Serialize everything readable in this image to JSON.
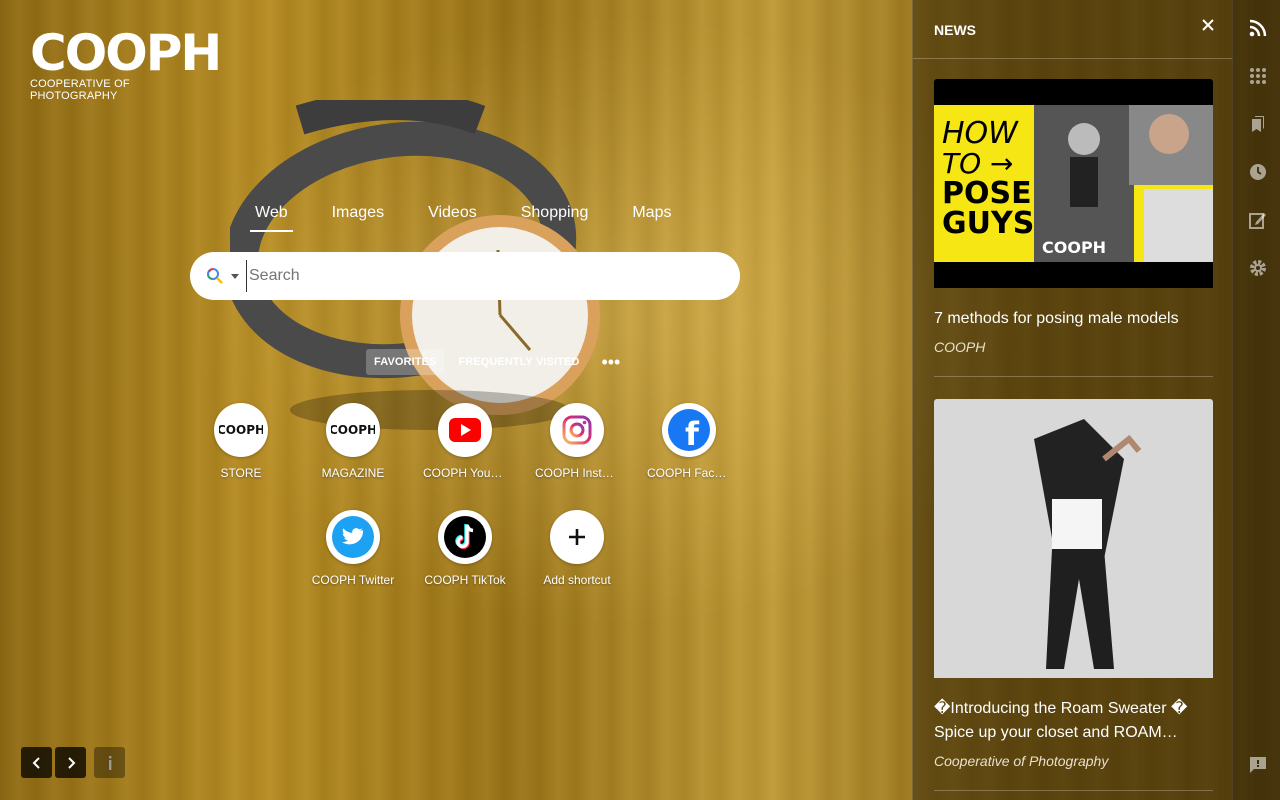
{
  "logo": {
    "main": "COOPH",
    "tagline": "COOPERATIVE OF PHOTOGRAPHY"
  },
  "search": {
    "tabs": [
      "Web",
      "Images",
      "Videos",
      "Shopping",
      "Maps"
    ],
    "active_tab": "Web",
    "placeholder": "Search",
    "value": ""
  },
  "shortcut_tabs": {
    "favorites": "FAVORITES",
    "frequently_visited": "FREQUENTLY VISITED",
    "active": "FAVORITES"
  },
  "shortcuts": [
    {
      "label": "STORE",
      "icon": "cooph-logo-icon"
    },
    {
      "label": "MAGAZINE",
      "icon": "cooph-logo-icon"
    },
    {
      "label": "COOPH YouTu…",
      "icon": "youtube-icon"
    },
    {
      "label": "COOPH Instagr…",
      "icon": "instagram-icon"
    },
    {
      "label": "COOPH Faceb…",
      "icon": "facebook-icon"
    },
    {
      "label": "COOPH Twitter",
      "icon": "twitter-icon"
    },
    {
      "label": "COOPH TikTok",
      "icon": "tiktok-icon"
    },
    {
      "label": "Add shortcut",
      "icon": "plus-icon"
    }
  ],
  "news": {
    "title": "NEWS",
    "items": [
      {
        "headline": "7 methods for posing male models",
        "source": "COOPH",
        "thumb_text": {
          "line1": "HOW",
          "line2": "TO →",
          "line3": "POSE",
          "line4": "GUYS",
          "brand": "COOPH"
        }
      },
      {
        "headline": "�Introducing the Roam Sweater � Spice up your closet and ROAM…",
        "source": "Cooperative of Photography"
      }
    ]
  },
  "colors": {
    "accent_yellow": "#f5e614",
    "news_panel_bg": "#34280a",
    "background_gold": "#a8801c"
  }
}
